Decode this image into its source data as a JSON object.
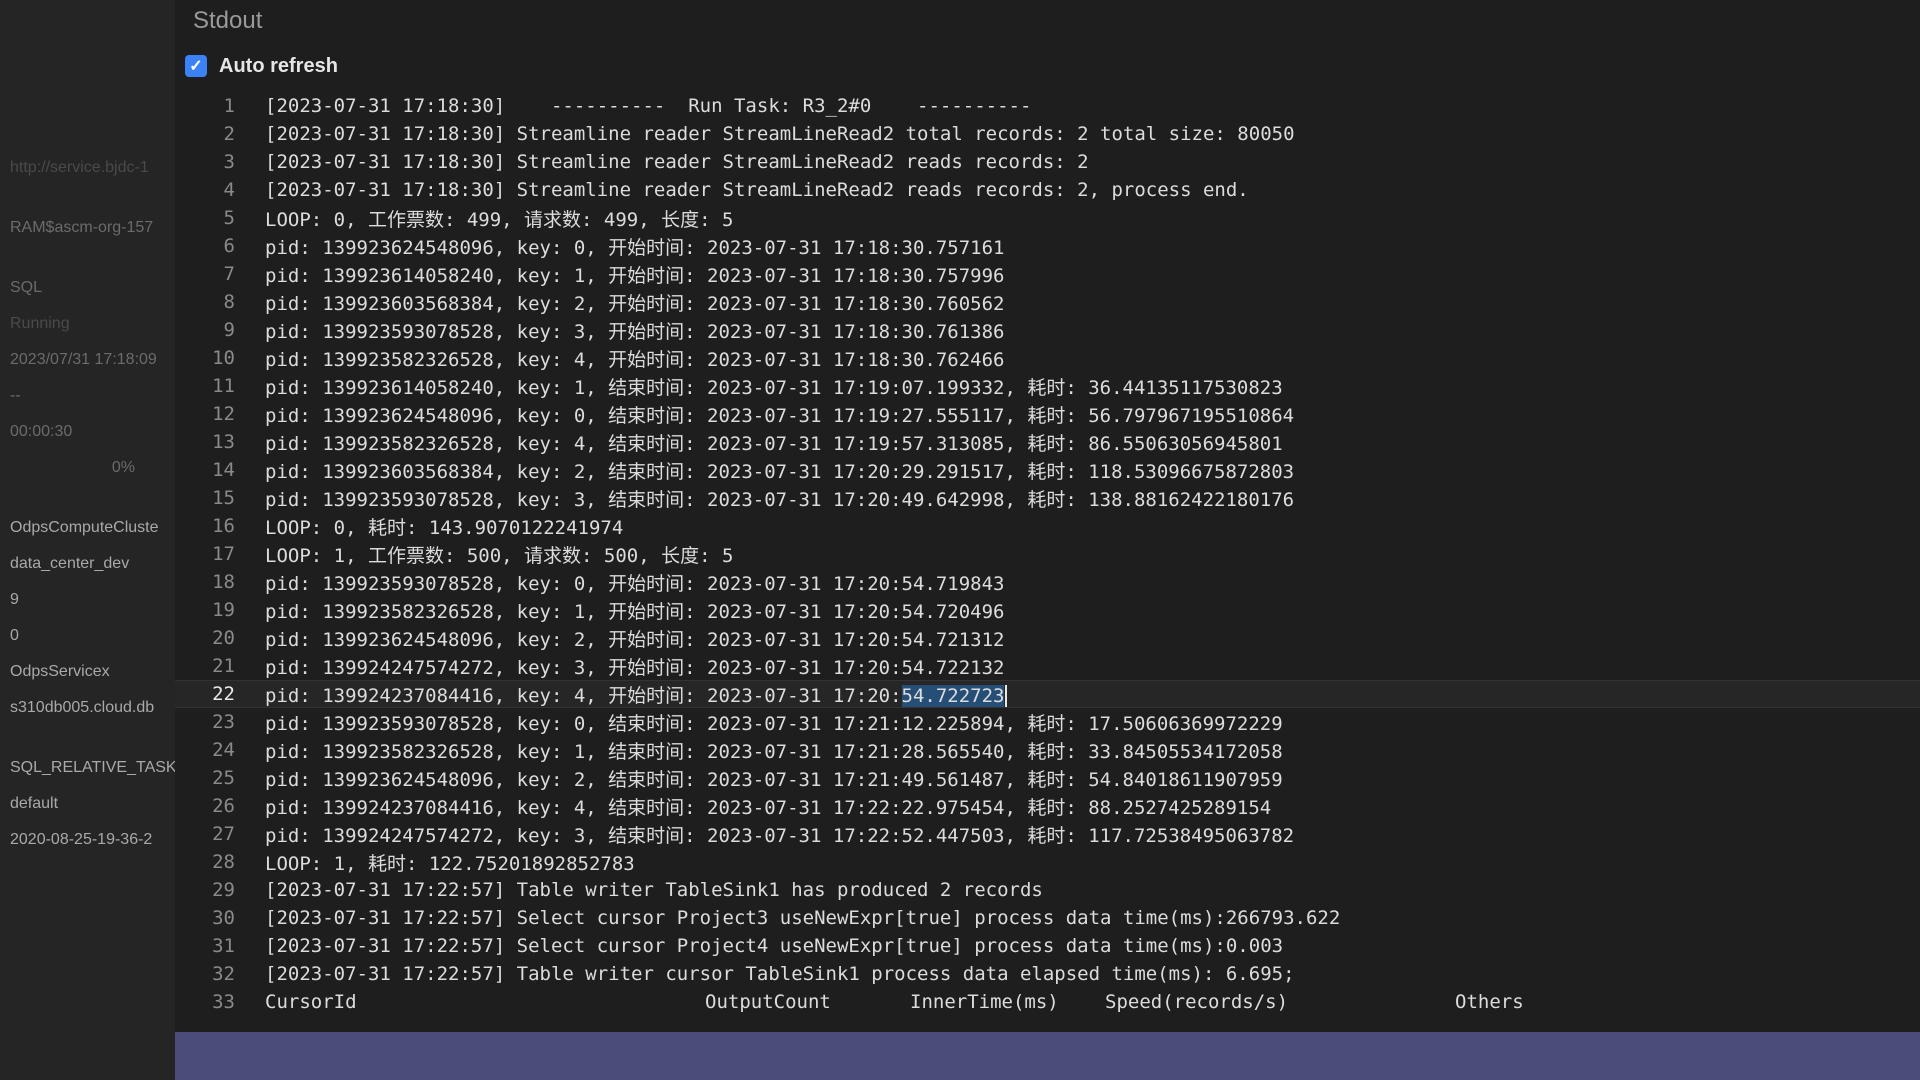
{
  "colors": {
    "accent": "#3b82f6",
    "bottom_bar": "#4c4c78"
  },
  "sidebar": {
    "items": [
      "http://service.bjdc-1",
      "RAM$ascm-org-157",
      "SQL",
      "Running",
      "2023/07/31 17:18:09",
      "--",
      "00:00:30",
      "0%",
      "OdpsComputeCluste",
      "data_center_dev",
      "9",
      "0",
      "OdpsServicex",
      "s310db005.cloud.db",
      "SQL_RELATIVE_TASK",
      "default",
      "2020-08-25-19-36-2"
    ]
  },
  "header": {
    "title": "Stdout"
  },
  "auto_refresh": {
    "label": "Auto refresh",
    "checked_icon": "✓"
  },
  "console": {
    "lines": [
      {
        "n": "1",
        "t": "[2023-07-31 17:18:30]    ----------  Run Task: R3_2#0    ----------"
      },
      {
        "n": "2",
        "t": "[2023-07-31 17:18:30] Streamline reader StreamLineRead2 total records: 2 total size: 80050"
      },
      {
        "n": "3",
        "t": "[2023-07-31 17:18:30] Streamline reader StreamLineRead2 reads records: 2"
      },
      {
        "n": "4",
        "t": "[2023-07-31 17:18:30] Streamline reader StreamLineRead2 reads records: 2, process end."
      },
      {
        "n": "5",
        "t": "LOOP: 0, 工作票数: 499, 请求数: 499, 长度: 5"
      },
      {
        "n": "6",
        "t": "pid: 139923624548096, key: 0, 开始时间: 2023-07-31 17:18:30.757161"
      },
      {
        "n": "7",
        "t": "pid: 139923614058240, key: 1, 开始时间: 2023-07-31 17:18:30.757996"
      },
      {
        "n": "8",
        "t": "pid: 139923603568384, key: 2, 开始时间: 2023-07-31 17:18:30.760562"
      },
      {
        "n": "9",
        "t": "pid: 139923593078528, key: 3, 开始时间: 2023-07-31 17:18:30.761386"
      },
      {
        "n": "10",
        "t": "pid: 139923582326528, key: 4, 开始时间: 2023-07-31 17:18:30.762466"
      },
      {
        "n": "11",
        "t": "pid: 139923614058240, key: 1, 结束时间: 2023-07-31 17:19:07.199332, 耗时: 36.44135117530823"
      },
      {
        "n": "12",
        "t": "pid: 139923624548096, key: 0, 结束时间: 2023-07-31 17:19:27.555117, 耗时: 56.797967195510864"
      },
      {
        "n": "13",
        "t": "pid: 139923582326528, key: 4, 结束时间: 2023-07-31 17:19:57.313085, 耗时: 86.55063056945801"
      },
      {
        "n": "14",
        "t": "pid: 139923603568384, key: 2, 结束时间: 2023-07-31 17:20:29.291517, 耗时: 118.53096675872803"
      },
      {
        "n": "15",
        "t": "pid: 139923593078528, key: 3, 结束时间: 2023-07-31 17:20:49.642998, 耗时: 138.88162422180176"
      },
      {
        "n": "16",
        "t": "LOOP: 0, 耗时: 143.9070122241974"
      },
      {
        "n": "17",
        "t": "LOOP: 1, 工作票数: 500, 请求数: 500, 长度: 5"
      },
      {
        "n": "18",
        "t": "pid: 139923593078528, key: 0, 开始时间: 2023-07-31 17:20:54.719843"
      },
      {
        "n": "19",
        "t": "pid: 139923582326528, key: 1, 开始时间: 2023-07-31 17:20:54.720496"
      },
      {
        "n": "20",
        "t": "pid: 139923624548096, key: 2, 开始时间: 2023-07-31 17:20:54.721312"
      },
      {
        "n": "21",
        "t": "pid: 139924247574272, key: 3, 开始时间: 2023-07-31 17:20:54.722132"
      },
      {
        "n": "22",
        "t_pre": "pid: 139924237084416, key: 4, 开始时间: 2023-07-31 17:20:",
        "t_sel": "54.722723"
      },
      {
        "n": "23",
        "t": "pid: 139923593078528, key: 0, 结束时间: 2023-07-31 17:21:12.225894, 耗时: 17.50606369972229"
      },
      {
        "n": "24",
        "t": "pid: 139923582326528, key: 1, 结束时间: 2023-07-31 17:21:28.565540, 耗时: 33.84505534172058"
      },
      {
        "n": "25",
        "t": "pid: 139923624548096, key: 2, 结束时间: 2023-07-31 17:21:49.561487, 耗时: 54.84018611907959"
      },
      {
        "n": "26",
        "t": "pid: 139924237084416, key: 4, 结束时间: 2023-07-31 17:22:22.975454, 耗时: 88.2527425289154"
      },
      {
        "n": "27",
        "t": "pid: 139924247574272, key: 3, 结束时间: 2023-07-31 17:22:52.447503, 耗时: 117.72538495063782"
      },
      {
        "n": "28",
        "t": "LOOP: 1, 耗时: 122.7520189285278​3"
      },
      {
        "n": "29",
        "t": "[2023-07-31 17:22:57] Table writer TableSink1 has produced 2 records"
      },
      {
        "n": "30",
        "t": "[2023-07-31 17:22:57] Select cursor Project3 useNewExpr[true] process data time(ms):266793.622"
      },
      {
        "n": "31",
        "t": "[2023-07-31 17:22:57] Select cursor Project4 useNewExpr[true] process data time(ms):0.003"
      },
      {
        "n": "32",
        "t": "[2023-07-31 17:22:57] Table writer cursor TableSink1 process data elapsed time(ms): 6.695;"
      }
    ],
    "header_row": {
      "n": "33",
      "cursor_id": "CursorId",
      "output_count": "OutputCount",
      "inner_time": "InnerTime(ms)",
      "speed": "Speed(records/s)",
      "others": "Others"
    }
  }
}
